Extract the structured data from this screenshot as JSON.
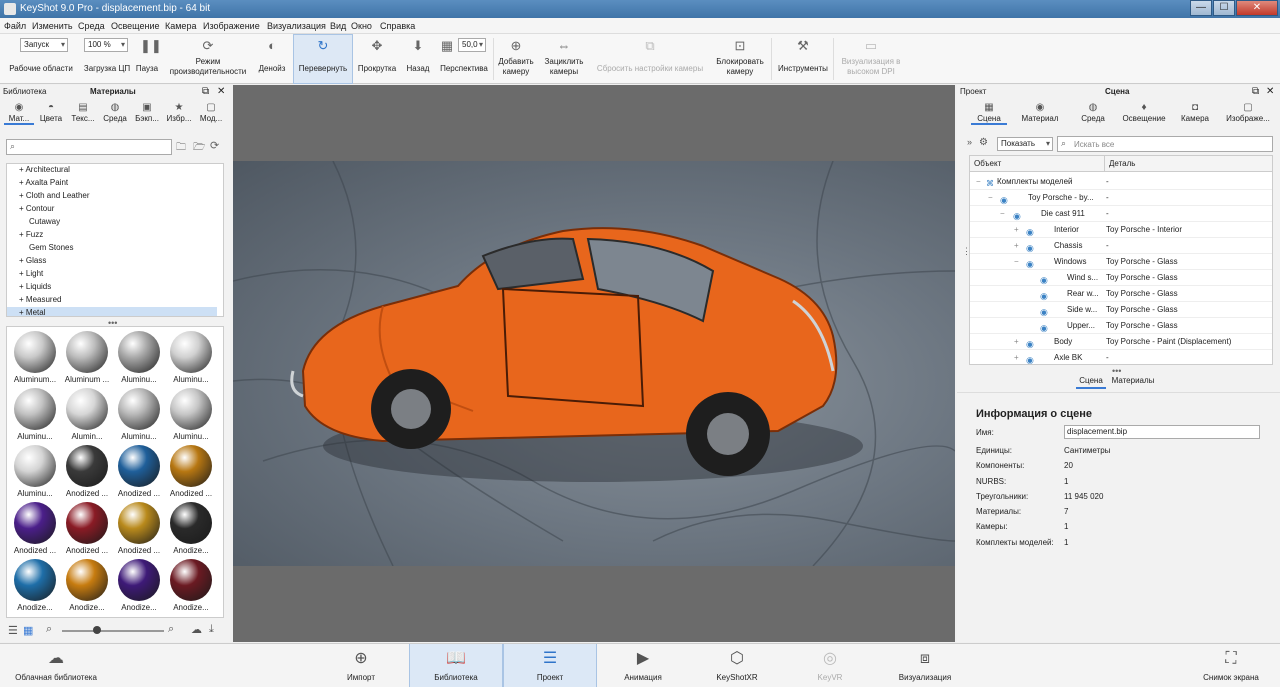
{
  "window": {
    "title": "KeyShot 9.0 Pro  - displacement.bip  - 64 bit",
    "min": "—",
    "max": "☐",
    "close": "✕"
  },
  "menu": [
    "Файл",
    "Изменить",
    "Среда",
    "Освещение",
    "Камера",
    "Изображение",
    "Визуализация",
    "Вид",
    "Окно",
    "Справка"
  ],
  "toolbar": {
    "workspace_value": "Запуск",
    "workspace_label": "Рабочие области",
    "cpu_value": "100 %",
    "cpu_label": "Загрузка ЦП",
    "pause": "Пауза",
    "perf_label1": "Режим",
    "perf_label2": "производительности",
    "denoise": "Денойз",
    "flip": "Перевернуть",
    "scroll": "Прокрутка",
    "back": "Назад",
    "perspective_value": "50,0",
    "perspective": "Перспектива",
    "addcam1": "Добавить",
    "addcam2": "камеру",
    "loopcam1": "Зациклить",
    "loopcam2": "камеры",
    "resetcam": "Сбросить настройки камеры",
    "lockcam1": "Блокировать",
    "lockcam2": "камеру",
    "tools": "Инструменты",
    "hidpi1": "Визуализация в",
    "hidpi2": "высоком DPI"
  },
  "library": {
    "header_left": "Библиотека",
    "header_title": "Материалы",
    "tabs": [
      "Мат...",
      "Цвета",
      "Текс...",
      "Среда",
      "Бэкп...",
      "Избр...",
      "Мод..."
    ],
    "tree": [
      "Architectural",
      "Axalta Paint",
      "Cloth and Leather",
      "Contour",
      "Cutaway",
      "Fuzz",
      "Gem Stones",
      "Glass",
      "Light",
      "Liquids",
      "Measured",
      "Metal"
    ],
    "selected": "Metal",
    "materials": [
      {
        "name": "Aluminum...",
        "color": "#c9c9c9"
      },
      {
        "name": "Aluminum ...",
        "color": "#bdbdbd"
      },
      {
        "name": "Aluminu...",
        "color": "#a9a9a9"
      },
      {
        "name": "Aluminu...",
        "color": "#d0d0d0"
      },
      {
        "name": "Aluminu...",
        "color": "#c2c2c2"
      },
      {
        "name": "Alumin...",
        "color": "#d6d6d6"
      },
      {
        "name": "Aluminu...",
        "color": "#b8b8b8"
      },
      {
        "name": "Aluminu...",
        "color": "#c6c6c6"
      },
      {
        "name": "Aluminu...",
        "color": "#d4d4d4"
      },
      {
        "name": "Anodized ...",
        "color": "#3a3a3a"
      },
      {
        "name": "Anodized ...",
        "color": "#1f5f9a"
      },
      {
        "name": "Anodized ...",
        "color": "#b77712"
      },
      {
        "name": "Anodized ...",
        "color": "#4b1f8a"
      },
      {
        "name": "Anodized ...",
        "color": "#8a1b25"
      },
      {
        "name": "Anodized ...",
        "color": "#b98a1c"
      },
      {
        "name": "Anodize...",
        "color": "#2a2a2a"
      },
      {
        "name": "Anodize...",
        "color": "#1e6ea8"
      },
      {
        "name": "Anodize...",
        "color": "#c77c10"
      },
      {
        "name": "Anodize...",
        "color": "#3e1a78"
      },
      {
        "name": "Anodize...",
        "color": "#6b1a22"
      }
    ]
  },
  "project": {
    "header_left": "Проект",
    "header_title": "Сцена",
    "tabs": [
      "Сцена",
      "Материал",
      "Среда",
      "Освещение",
      "Камера",
      "Изображе..."
    ],
    "show_btn": "Показать",
    "search_placeholder": "Искать все",
    "col_object": "Объект",
    "col_detail": "Деталь",
    "rows": [
      {
        "name": "Комплекты моделей",
        "detail": "-"
      },
      {
        "name": "Toy Porsche - by...",
        "detail": "-"
      },
      {
        "name": "Die cast 911",
        "detail": "-"
      },
      {
        "name": "Interior",
        "detail": "Toy Porsche - Interior"
      },
      {
        "name": "Chassis",
        "detail": "-"
      },
      {
        "name": "Windows",
        "detail": "Toy Porsche - Glass"
      },
      {
        "name": "Wind s...",
        "detail": "Toy Porsche - Glass"
      },
      {
        "name": "Rear w...",
        "detail": "Toy Porsche - Glass"
      },
      {
        "name": "Side w...",
        "detail": "Toy Porsche - Glass"
      },
      {
        "name": "Upper...",
        "detail": "Toy Porsche - Glass"
      },
      {
        "name": "Body",
        "detail": "Toy Porsche - Paint (Displacement)"
      },
      {
        "name": "Axle BK",
        "detail": "-"
      }
    ],
    "subtabs": [
      "Сцена",
      "Материалы"
    ],
    "info_title": "Информация о сцене",
    "info": [
      {
        "k": "Имя:",
        "v": "displacement.bip"
      },
      {
        "k": "Единицы:",
        "v": "Сантиметры"
      },
      {
        "k": "Компоненты:",
        "v": "20"
      },
      {
        "k": "NURBS:",
        "v": "1"
      },
      {
        "k": "Треугольники:",
        "v": "11 945 020"
      },
      {
        "k": "Материалы:",
        "v": "7"
      },
      {
        "k": "Камеры:",
        "v": "1"
      },
      {
        "k": "Комплекты моделей:",
        "v": "1"
      }
    ]
  },
  "bottom": {
    "cloud": "Облачная библиотека",
    "import": "Импорт",
    "library": "Библиотека",
    "project": "Проект",
    "animation": "Анимация",
    "keyshotxr": "KeyShotXR",
    "keyvr": "KeyVR",
    "render": "Визуализация",
    "screenshot": "Снимок экрана"
  }
}
